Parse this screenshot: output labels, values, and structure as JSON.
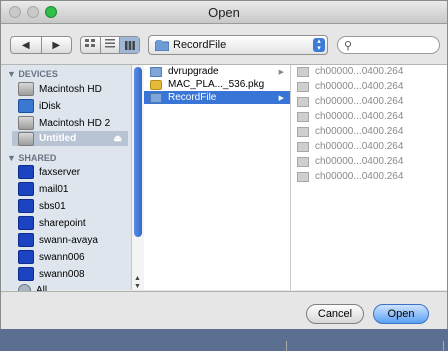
{
  "window": {
    "title": "Open"
  },
  "toolbar": {
    "back_icon": "triangle-left",
    "forward_icon": "triangle-right",
    "view_icons": [
      "icon-view",
      "list-view",
      "column-view"
    ],
    "location": "RecordFile",
    "search_placeholder": ""
  },
  "sidebar": {
    "devices_header": "DEVICES",
    "shared_header": "SHARED",
    "devices": [
      {
        "label": "Macintosh HD",
        "icon": "hard-drive"
      },
      {
        "label": "iDisk",
        "icon": "idisk"
      },
      {
        "label": "Macintosh HD 2",
        "icon": "hard-drive"
      },
      {
        "label": "Untitled",
        "icon": "hard-drive",
        "selected": true
      }
    ],
    "shared": [
      {
        "label": "faxserver",
        "icon": "monitor"
      },
      {
        "label": "mail01",
        "icon": "monitor"
      },
      {
        "label": "sbs01",
        "icon": "monitor"
      },
      {
        "label": "sharepoint",
        "icon": "monitor"
      },
      {
        "label": "swann-avaya",
        "icon": "monitor"
      },
      {
        "label": "swann006",
        "icon": "monitor"
      },
      {
        "label": "swann008",
        "icon": "monitor"
      },
      {
        "label": "All...",
        "icon": "network-globe"
      }
    ]
  },
  "column1": [
    {
      "name": "dvrupgrade",
      "type": "folder",
      "arrow": true
    },
    {
      "name": "MAC_PLA..._536.pkg",
      "type": "package"
    },
    {
      "name": "RecordFile",
      "type": "folder",
      "selected": true,
      "arrow": true
    }
  ],
  "column2": [
    {
      "name": "ch00000...0400.264"
    },
    {
      "name": "ch00000...0400.264"
    },
    {
      "name": "ch00000...0400.264"
    },
    {
      "name": "ch00000...0400.264"
    },
    {
      "name": "ch00000...0400.264"
    },
    {
      "name": "ch00000...0400.264"
    },
    {
      "name": "ch00000...0400.264"
    },
    {
      "name": "ch00000...0400.264"
    }
  ],
  "buttons": {
    "cancel": "Cancel",
    "open": "Open"
  }
}
